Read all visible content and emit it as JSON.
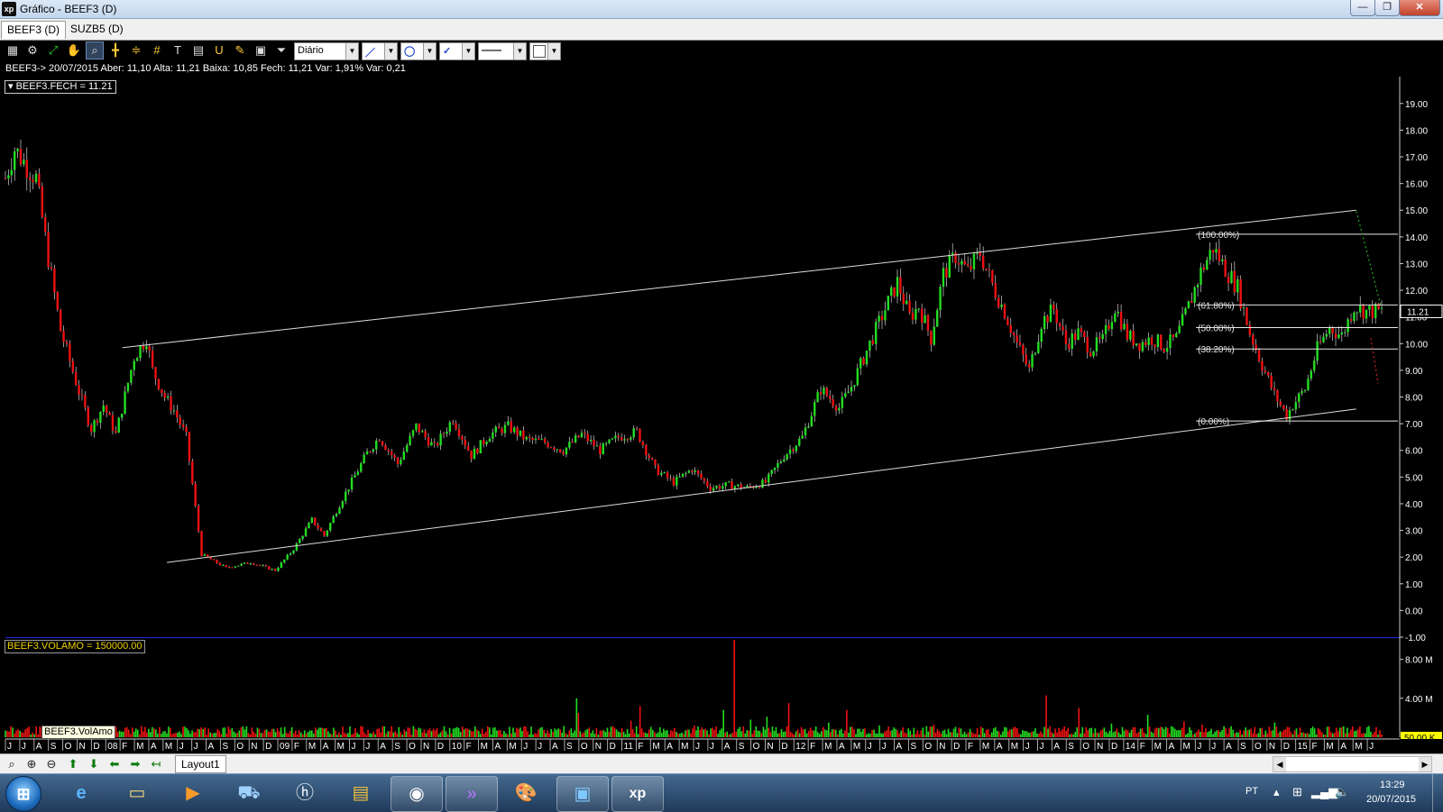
{
  "window": {
    "title": "Gráfico - BEEF3 (D)",
    "app_icon": "xp",
    "buttons": {
      "minimize": "—",
      "maximize": "❐",
      "close": "✕"
    }
  },
  "tabs": [
    {
      "label": "BEEF3 (D)",
      "active": true
    },
    {
      "label": "SUZB5 (D)",
      "active": false
    }
  ],
  "toolbar": {
    "icons": [
      "chart-type-icon",
      "settings-icon",
      "line-draw-icon",
      "hand-icon",
      "zoom-window-icon",
      "crosshair-icon",
      "parallel-lines-icon",
      "grid-icon",
      "text-tool-icon",
      "calculator-icon",
      "magnet-icon",
      "eraser-icon",
      "clipboard-icon",
      "filter-icon"
    ],
    "period": "Diário",
    "line_tool": "／",
    "circle_tool": "◯",
    "fan_tool": "✓",
    "line_style": "——",
    "color_box": ""
  },
  "info_line": "BEEF3-> 20/07/2015 Aber: 11,10 Alta: 11,21 Baixa: 10,85 Fech: 11,21 Var: 1,91% Var: 0,21",
  "price_legend": "▾ BEEF3.FECH = 11.21",
  "volume_legend": "BEEF3.VOLAMO = 150000.00",
  "tooltip": "BEEF3.VolAmo",
  "last_price": "11.21",
  "volume_axis_badge": "50.00 K",
  "colors": {
    "up": "#22dd22",
    "down": "#ee1111",
    "background": "#000000",
    "axis_text": "#ffffff",
    "channel_lines": "#dddddd",
    "separator": "#1f28c8",
    "forecast_up": "#22aa22",
    "forecast_down": "#cc2222"
  },
  "fibonacci": [
    {
      "label": "(100.00%)",
      "price": 14.1
    },
    {
      "label": "(61.80%)",
      "price": 11.45
    },
    {
      "label": "(50.00%)",
      "price": 10.6
    },
    {
      "label": "(38.20%)",
      "price": 9.8
    },
    {
      "label": "(0.00%)",
      "price": 7.1
    }
  ],
  "chart_data": {
    "type": "candlestick",
    "symbol": "BEEF3",
    "price_axis": {
      "ticks": [
        "19.00",
        "18.00",
        "17.00",
        "16.00",
        "15.00",
        "14.00",
        "13.00",
        "12.00",
        "11.00",
        "10.00",
        "9.00",
        "8.00",
        "7.00",
        "6.00",
        "5.00",
        "4.00",
        "3.00",
        "2.00",
        "1.00",
        "0.00",
        "-1.00"
      ],
      "ylim": [
        -1,
        19.5
      ]
    },
    "volume_axis": {
      "ticks": [
        "8.00 M",
        "4.00 M"
      ],
      "ylim": [
        0,
        10
      ]
    },
    "x_axis": {
      "labels": [
        "J",
        "J",
        "A",
        "S",
        "O",
        "N",
        "D",
        "08",
        "F",
        "M",
        "A",
        "M",
        "J",
        "J",
        "A",
        "S",
        "O",
        "N",
        "D",
        "09",
        "F",
        "M",
        "A",
        "M",
        "J",
        "J",
        "A",
        "S",
        "O",
        "N",
        "D",
        "10",
        "F",
        "M",
        "A",
        "M",
        "J",
        "J",
        "A",
        "S",
        "O",
        "N",
        "D",
        "11",
        "F",
        "M",
        "A",
        "M",
        "J",
        "J",
        "A",
        "S",
        "O",
        "N",
        "D",
        "12",
        "F",
        "M",
        "A",
        "M",
        "J",
        "J",
        "A",
        "S",
        "O",
        "N",
        "D",
        "F",
        "M",
        "A",
        "M",
        "J",
        "J",
        "A",
        "S",
        "O",
        "N",
        "D",
        "14",
        "F",
        "M",
        "A",
        "M",
        "J",
        "J",
        "A",
        "S",
        "O",
        "N",
        "D",
        "15",
        "F",
        "M",
        "A",
        "M",
        "J"
      ]
    },
    "price_path": [
      [
        0,
        16.2
      ],
      [
        3,
        17.3
      ],
      [
        10,
        16.2
      ],
      [
        14,
        13.2
      ],
      [
        18,
        10.5
      ],
      [
        24,
        8.2
      ],
      [
        28,
        6.8
      ],
      [
        32,
        7.7
      ],
      [
        36,
        6.6
      ],
      [
        42,
        9.5
      ],
      [
        46,
        10.2
      ],
      [
        48,
        9.0
      ],
      [
        52,
        8.0
      ],
      [
        55,
        7.5
      ],
      [
        59,
        6.5
      ],
      [
        64,
        2.1
      ],
      [
        72,
        1.6
      ],
      [
        80,
        1.8
      ],
      [
        88,
        1.5
      ],
      [
        94,
        2.3
      ],
      [
        100,
        3.4
      ],
      [
        104,
        2.8
      ],
      [
        110,
        4.2
      ],
      [
        118,
        5.9
      ],
      [
        122,
        6.5
      ],
      [
        128,
        5.5
      ],
      [
        134,
        6.9
      ],
      [
        140,
        6.1
      ],
      [
        146,
        7.2
      ],
      [
        152,
        5.8
      ],
      [
        158,
        6.6
      ],
      [
        164,
        6.9
      ],
      [
        170,
        6.4
      ],
      [
        176,
        6.3
      ],
      [
        182,
        6.0
      ],
      [
        188,
        6.6
      ],
      [
        194,
        6.0
      ],
      [
        200,
        6.5
      ],
      [
        206,
        6.7
      ],
      [
        212,
        5.3
      ],
      [
        218,
        4.8
      ],
      [
        224,
        5.3
      ],
      [
        230,
        4.6
      ],
      [
        236,
        4.7
      ],
      [
        242,
        4.6
      ],
      [
        248,
        4.8
      ],
      [
        254,
        5.8
      ],
      [
        260,
        6.5
      ],
      [
        266,
        8.3
      ],
      [
        272,
        7.6
      ],
      [
        276,
        8.4
      ],
      [
        282,
        10.0
      ],
      [
        287,
        11.3
      ],
      [
        291,
        12.3
      ],
      [
        295,
        11.0
      ],
      [
        298,
        11.4
      ],
      [
        302,
        10.2
      ],
      [
        306,
        12.6
      ],
      [
        310,
        13.3
      ],
      [
        314,
        12.7
      ],
      [
        318,
        13.4
      ],
      [
        322,
        12.2
      ],
      [
        326,
        11.2
      ],
      [
        330,
        10.0
      ],
      [
        334,
        9.0
      ],
      [
        338,
        10.8
      ],
      [
        342,
        11.3
      ],
      [
        346,
        10.0
      ],
      [
        350,
        10.4
      ],
      [
        354,
        9.8
      ],
      [
        358,
        10.1
      ],
      [
        362,
        11.4
      ],
      [
        366,
        10.3
      ],
      [
        370,
        10.0
      ],
      [
        374,
        10.2
      ],
      [
        378,
        9.9
      ],
      [
        382,
        10.2
      ],
      [
        386,
        11.4
      ],
      [
        390,
        12.7
      ],
      [
        394,
        13.6
      ],
      [
        398,
        12.8
      ],
      [
        402,
        12.1
      ],
      [
        406,
        10.4
      ],
      [
        410,
        9.2
      ],
      [
        414,
        8.1
      ],
      [
        418,
        7.3
      ],
      [
        420,
        7.7
      ],
      [
        424,
        8.3
      ],
      [
        428,
        9.8
      ],
      [
        432,
        10.6
      ],
      [
        436,
        10.3
      ],
      [
        440,
        11.4
      ],
      [
        444,
        11.21
      ]
    ],
    "volume_spikes": [
      [
        315,
        4.0
      ],
      [
        316,
        2.5
      ],
      [
        345,
        1.7
      ],
      [
        350,
        3.2
      ],
      [
        380,
        1.2
      ],
      [
        396,
        2.8
      ],
      [
        402,
        10.0
      ],
      [
        411,
        1.8
      ],
      [
        420,
        2.1
      ],
      [
        432,
        3.5
      ],
      [
        454,
        1.5
      ],
      [
        464,
        2.8
      ],
      [
        482,
        1.2
      ],
      [
        498,
        0.9
      ],
      [
        512,
        1.3
      ],
      [
        574,
        4.3
      ],
      [
        592,
        3.0
      ],
      [
        610,
        1.4
      ],
      [
        630,
        2.3
      ],
      [
        650,
        1.6
      ],
      [
        660,
        1.3
      ],
      [
        684,
        1.0
      ],
      [
        700,
        1.5
      ],
      [
        730,
        1.1
      ]
    ],
    "channel_upper": [
      [
        0.084,
        9.85
      ],
      [
        0.97,
        15.0
      ]
    ],
    "channel_lower": [
      [
        0.116,
        1.8
      ],
      [
        0.97,
        7.55
      ]
    ],
    "fib_anchor": [
      0.855,
      14.1
    ]
  },
  "bottom": {
    "layout_tab": "Layout1",
    "tools": [
      "zoom-icon",
      "zoom-in-icon",
      "zoom-out-icon",
      "arrow-up-icon",
      "arrow-down-icon",
      "arrow-left-icon",
      "arrow-right-icon",
      "arrow-back-icon"
    ]
  },
  "taskbar": {
    "apps": [
      "internet-explorer-icon",
      "file-explorer-icon",
      "media-player-icon",
      "remote-access-icon",
      "hp-icon",
      "presentation-icon",
      "chrome-icon",
      "forward-app-icon",
      "paint-icon",
      "photo-viewer-icon",
      "xp-app-icon"
    ],
    "lang": "PT",
    "time": "13:29",
    "date": "20/07/2015"
  }
}
